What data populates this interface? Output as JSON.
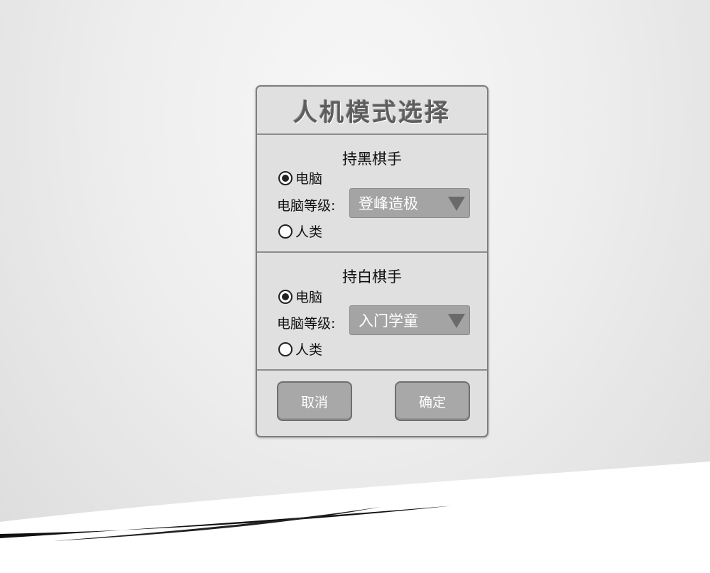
{
  "dialog": {
    "title": "人机模式选择"
  },
  "black_player": {
    "heading": "持黑棋手",
    "option_computer": "电脑",
    "option_human": "人类",
    "level_label": "电脑等级:",
    "level_value": "登峰造极",
    "selected": "computer"
  },
  "white_player": {
    "heading": "持白棋手",
    "option_computer": "电脑",
    "option_human": "人类",
    "level_label": "电脑等级:",
    "level_value": "入门学童",
    "selected": "computer"
  },
  "actions": {
    "cancel_label": "取消",
    "confirm_label": "确定"
  },
  "colors": {
    "dialog_bg": "#e0e0e0",
    "button_bg": "#a8a8a8",
    "select_bg": "#a4a4a4"
  }
}
